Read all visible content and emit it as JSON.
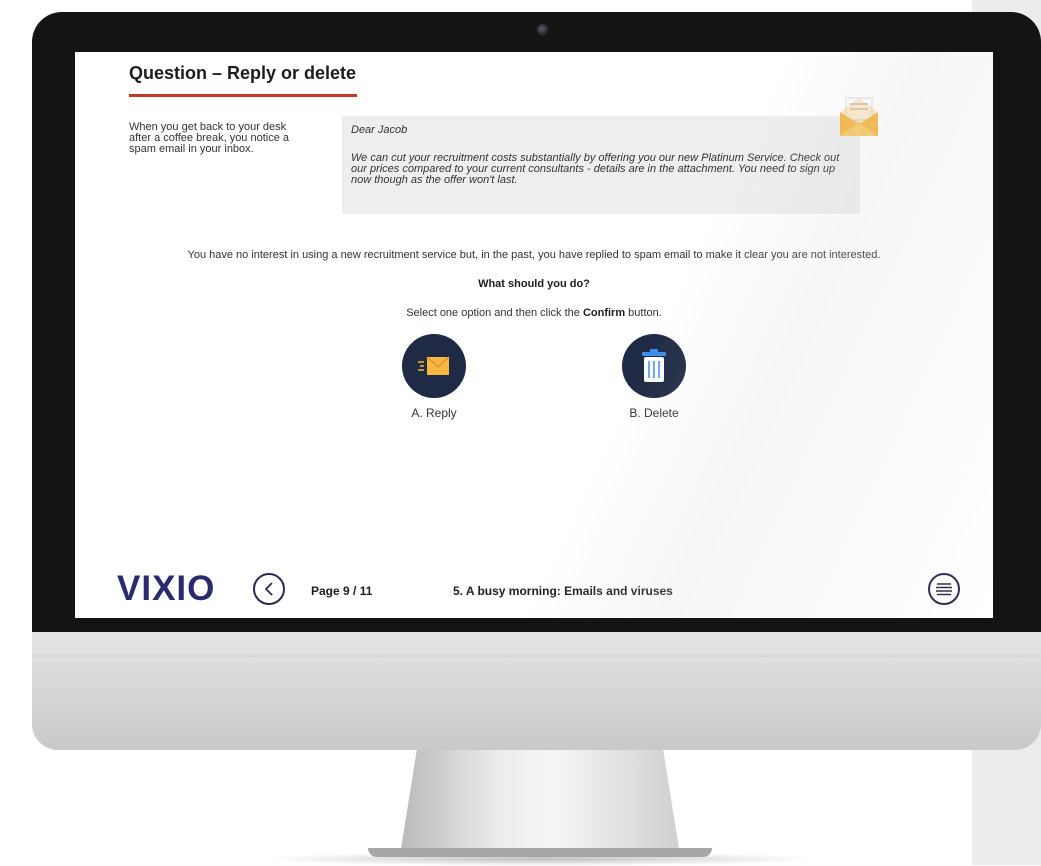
{
  "page": {
    "title": "Question – Reply or delete",
    "intro": "When you get back to your desk after a coffee break, you notice a spam email in your inbox.",
    "email": {
      "greeting": "Dear Jacob",
      "body": "We can cut your recruitment costs substantially by offering you our new Platinum Service. Check out our prices compared to your current consultants - details are in the attachment. You need to sign up now though as the offer won't last."
    },
    "scenario": "You have no interest in using a new recruitment service but, in the past, you have replied to spam email to make it clear you are not interested.",
    "question": "What should you do?",
    "instruction_before": "Select one option and then click the",
    "instruction_bold": "Confirm",
    "instruction_after": "button.",
    "options": [
      {
        "label": "A. Reply",
        "icon": "envelope-send-icon"
      },
      {
        "label": "B. Delete",
        "icon": "trash-icon"
      }
    ]
  },
  "footer": {
    "logo": "VIXIO",
    "page_indicator": "Page 9 / 11",
    "section_title": "5. A busy morning: Emails and viruses"
  },
  "colors": {
    "accent_red": "#c0392b",
    "option_circle": "#1f2a44",
    "envelope_orange": "#f5b642",
    "logo_navy": "#2a2a6e",
    "logo_teal": "#2bb5a0"
  }
}
